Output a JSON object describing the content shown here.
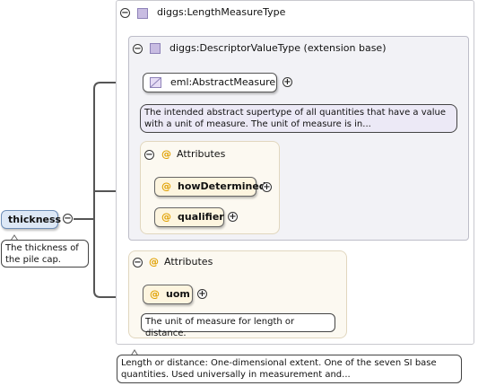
{
  "root_element": {
    "name": "thickness",
    "doc": [
      "The thickness of",
      "the pile cap."
    ]
  },
  "type": {
    "name": "diggs:LengthMeasureType",
    "doc": [
      "Length or distance: One-dimensional extent. One of the seven SI base",
      "quantities. Used universally in measurement and..."
    ]
  },
  "extension": {
    "name": "diggs:DescriptorValueType (extension base)",
    "abstract_element": {
      "name": "eml:AbstractMeasure",
      "doc": [
        "The intended abstract supertype of all quantities that have a value",
        "with a unit of measure. The unit of measure is in..."
      ]
    },
    "attributes": {
      "title": "Attributes",
      "items": [
        {
          "name": "howDetermined"
        },
        {
          "name": "qualifier"
        }
      ]
    }
  },
  "attributes": {
    "title": "Attributes",
    "items": [
      {
        "name": "uom",
        "doc": "The unit of measure for length or distance."
      }
    ]
  },
  "symbols": {
    "collapse": "−",
    "expand": "+",
    "attribute": "@"
  },
  "colors": {
    "attribute_accent": "#e0a000",
    "type_icon": "#c8bce2",
    "element_fill": "#dde8f6"
  }
}
